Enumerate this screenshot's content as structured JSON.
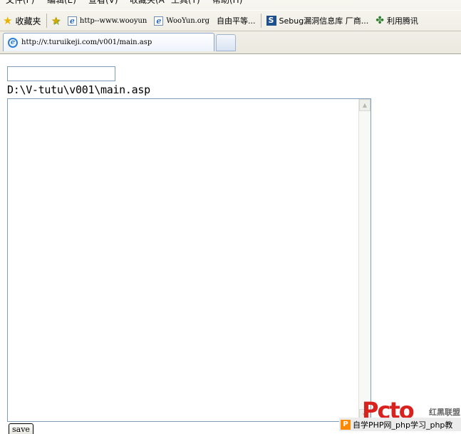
{
  "menubar": {
    "items": [
      "文件(F)",
      "编辑(E)",
      "查看(V)",
      "收藏夹(A)",
      "工具(T)",
      "帮助(H)"
    ]
  },
  "favorites_bar": {
    "favorites_label": "收藏夹",
    "links": [
      {
        "label": "http--www.wooyun",
        "icon": "ie-page-icon"
      },
      {
        "label": "WooYun.org",
        "icon": "ie-page-icon"
      },
      {
        "label": "自由平等...",
        "icon": "none"
      },
      {
        "label": "Sebug漏洞信息库 厂商...",
        "icon": "sebug-s-icon"
      },
      {
        "label": "利用腾讯",
        "icon": "figure-icon"
      }
    ]
  },
  "tabs": {
    "active_title": "http://v.turuikeji.com/v001/main.asp"
  },
  "page": {
    "path_input_value": "",
    "file_path": "D:\\V-tutu\\v001\\main.asp",
    "editor_content": "",
    "save_label": "save"
  },
  "watermark": {
    "logo_text": "Pcto",
    "brand": "红黑联盟",
    "strip_text": "自学PHP网_php学习_php教"
  },
  "colors": {
    "chrome_bg": "#ebe9df",
    "tab_border": "#8aa3c9",
    "input_border": "#7f9db9",
    "watermark_red": "#d9211e",
    "watermark_orange": "#ff8a00"
  }
}
